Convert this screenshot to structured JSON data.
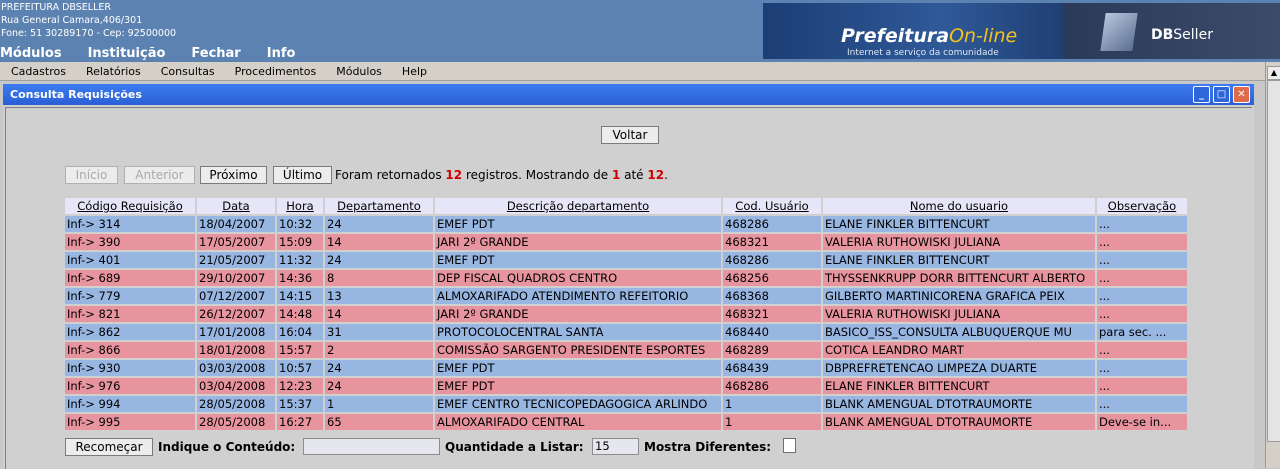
{
  "header": {
    "company": "PREFEITURA DBSELLER",
    "address": "Rua General Camara,406/301",
    "phone": "Fone: 51 30289170  -  Cep: 92500000",
    "menu": [
      "Módulos",
      "Instituição",
      "Fechar",
      "Info"
    ],
    "logo_main": "Prefeitura",
    "logo_online": "On-line",
    "logo_sub": "Internet a serviço da comunidade",
    "vendor_db": "DB",
    "vendor_seller": "Seller"
  },
  "menubar": [
    "Cadastros",
    "Relatórios",
    "Consultas",
    "Procedimentos",
    "Módulos",
    "Help"
  ],
  "window": {
    "title": "Consulta Requisições",
    "minimize": "_",
    "maximize": "□",
    "close": "✕"
  },
  "voltar": "Voltar",
  "nav": {
    "inicio": "Início",
    "anterior": "Anterior",
    "proximo": "Próximo",
    "ultimo": "Último",
    "status_prefix": "Foram retornados ",
    "total": "12",
    "status_mid": " registros. Mostrando de ",
    "from": "1",
    "status_ate": " até ",
    "to": "12",
    "status_end": "."
  },
  "table": {
    "headers": [
      "Código Requisição",
      "Data",
      "Hora",
      "Departamento",
      "Descrição departamento",
      "Cod. Usuário",
      "Nome do usuario",
      "Observação"
    ],
    "rows": [
      [
        "Inf-> 314",
        "18/04/2007",
        "10:32",
        "24",
        "EMEF PDT",
        "468286",
        "ELANE FINKLER BITTENCURT",
        "..."
      ],
      [
        "Inf-> 390",
        "17/05/2007",
        "15:09",
        "14",
        "JARI 2º GRANDE",
        "468321",
        "VALERIA RUTHOWISKI JULIANA",
        "..."
      ],
      [
        "Inf-> 401",
        "21/05/2007",
        "11:32",
        "24",
        "EMEF PDT",
        "468286",
        "ELANE FINKLER BITTENCURT",
        "..."
      ],
      [
        "Inf-> 689",
        "29/10/2007",
        "14:36",
        "8",
        "DEP FISCAL QUADROS CENTRO",
        "468256",
        "THYSSENKRUPP DORR BITTENCURT ALBERTO",
        "..."
      ],
      [
        "Inf-> 779",
        "07/12/2007",
        "14:15",
        "13",
        "ALMOXARIFADO ATENDIMENTO REFEITORIO",
        "468368",
        "GILBERTO MARTINICORENA GRAFICA PEIX",
        "..."
      ],
      [
        "Inf-> 821",
        "26/12/2007",
        "14:48",
        "14",
        "JARI 2º GRANDE",
        "468321",
        "VALERIA RUTHOWISKI JULIANA",
        "..."
      ],
      [
        "Inf-> 862",
        "17/01/2008",
        "16:04",
        "31",
        "PROTOCOLOCENTRAL SANTA",
        "468440",
        "BASICO_ISS_CONSULTA ALBUQUERQUE MU",
        "para sec. ..."
      ],
      [
        "Inf-> 866",
        "18/01/2008",
        "15:57",
        "2",
        "COMISSÃO SARGENTO PRESIDENTE ESPORTES",
        "468289",
        "COTICA LEANDRO MART",
        "..."
      ],
      [
        "Inf-> 930",
        "03/03/2008",
        "10:57",
        "24",
        "EMEF PDT",
        "468439",
        "DBPREFRETENCAO LIMPEZA DUARTE",
        "..."
      ],
      [
        "Inf-> 976",
        "03/04/2008",
        "12:23",
        "24",
        "EMEF PDT",
        "468286",
        "ELANE FINKLER BITTENCURT",
        "..."
      ],
      [
        "Inf-> 994",
        "28/05/2008",
        "15:37",
        "1",
        "EMEF CENTRO TECNICOPEDAGOGICA ARLINDO",
        "1",
        "BLANK AMENGUAL DTOTRAUMORTE",
        "..."
      ],
      [
        "Inf-> 995",
        "28/05/2008",
        "16:27",
        "65",
        "ALMOXARIFADO CENTRAL",
        "1",
        "BLANK AMENGUAL DTOTRAUMORTE",
        "Deve-se in..."
      ]
    ]
  },
  "bottom": {
    "recomecar": "Recomeçar",
    "indique_label": "Indique o Conteúdo:",
    "indique_value": "",
    "quantidade_label": "Quantidade a Listar:",
    "quantidade_value": "15",
    "mostra_label": "Mostra Diferentes:"
  },
  "colors": {
    "row_blue": "#98b6e2",
    "row_pink": "#e8949f",
    "header_bg": "#5b82b1",
    "titlebar": "#2a5fd6",
    "count_red": "#d00000"
  }
}
